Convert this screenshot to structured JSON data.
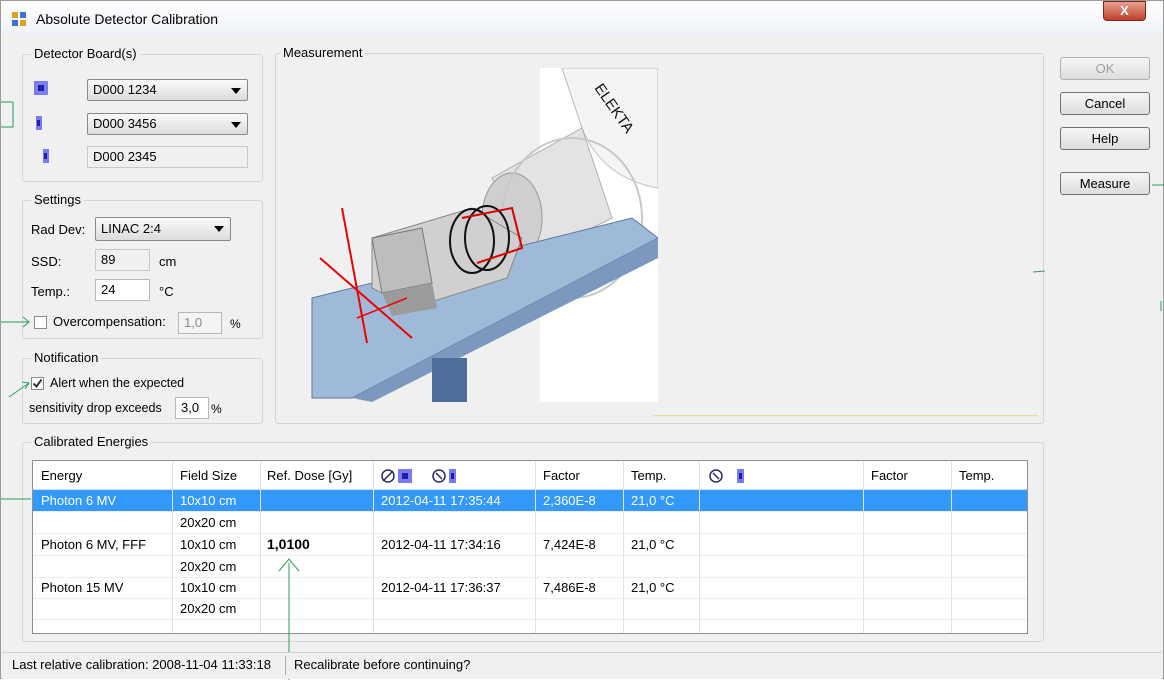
{
  "window": {
    "title": "Absolute Detector Calibration",
    "close_label": "X"
  },
  "detector_boards": {
    "label": "Detector Board(s)",
    "board1": "D000 1234",
    "board2": "D000 3456",
    "board3": "D000 2345"
  },
  "settings": {
    "label": "Settings",
    "rad_dev_label": "Rad Dev:",
    "rad_dev_value": "LINAC 2:4",
    "ssd_label": "SSD:",
    "ssd_value": "89",
    "ssd_unit": "cm",
    "temp_label": "Temp.:",
    "temp_value": "24",
    "temp_unit": "°C",
    "overcomp_label": "Overcompensation:",
    "overcomp_value": "1,0",
    "overcomp_unit": "%",
    "overcomp_checked": false
  },
  "notification": {
    "label": "Notification",
    "alert_line1": "Alert when the expected",
    "alert_line2": "sensitivity drop exceeds",
    "alert_value": "3,0",
    "alert_unit": "%",
    "alert_checked": true
  },
  "measurement": {
    "label": "Measurement",
    "logo_text": "ELEKTA"
  },
  "buttons": {
    "ok": "OK",
    "cancel": "Cancel",
    "help": "Help",
    "measure": "Measure"
  },
  "calibrated_energies": {
    "label": "Calibrated Energies",
    "columns": [
      "Energy",
      "Field Size",
      "Ref. Dose [Gy]",
      "",
      "Factor",
      "Temp.",
      "",
      "Factor",
      "Temp."
    ],
    "rows": [
      {
        "energy": "Photon 6 MV",
        "field": "10x10 cm",
        "dose": "",
        "time": "2012-04-11 17:35:44",
        "factor": "2,360E-8",
        "temp": "21,0 °C",
        "selected": true
      },
      {
        "energy": "",
        "field": "20x20 cm",
        "dose": "",
        "time": "",
        "factor": "",
        "temp": "",
        "selected": false
      },
      {
        "energy": "Photon 6 MV, FFF",
        "field": "10x10 cm",
        "dose": "1,0100",
        "time": "2012-04-11 17:34:16",
        "factor": "7,424E-8",
        "temp": "21,0 °C",
        "selected": false
      },
      {
        "energy": "",
        "field": "20x20 cm",
        "dose": "",
        "time": "",
        "factor": "",
        "temp": "",
        "selected": false
      },
      {
        "energy": "Photon 15 MV",
        "field": "10x10 cm",
        "dose": "",
        "time": "2012-04-11 17:36:37",
        "factor": "7,486E-8",
        "temp": "21,0 °C",
        "selected": false
      },
      {
        "energy": "",
        "field": "20x20 cm",
        "dose": "",
        "time": "",
        "factor": "",
        "temp": "",
        "selected": false
      }
    ]
  },
  "status": {
    "last_calibration": "Last relative calibration: 2008-11-04 11:33:18",
    "recalibrate": "Recalibrate before continuing?"
  },
  "colors": {
    "selection": "#3399ff",
    "detector_icon": "#7b7bf5",
    "annotation": "#2a9d5a"
  }
}
